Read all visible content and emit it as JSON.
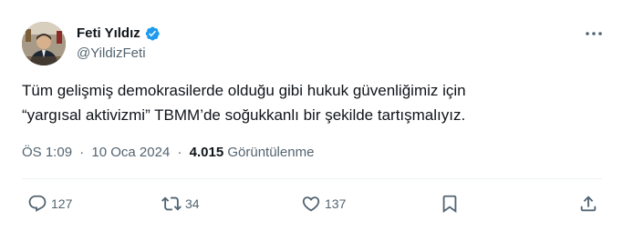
{
  "author": {
    "name": "Feti Yıldız",
    "handle": "@YildizFeti",
    "verified": true
  },
  "tweet": {
    "lines": [
      "Tüm gelişmiş demokrasilerde olduğu gibi hukuk güvenliğimiz için",
      "“yargısal aktivizmi” TBMM’de soğukkanlı bir şekilde tartışmalıyız."
    ]
  },
  "meta": {
    "time": "ÖS 1:09",
    "date": "10 Oca 2024",
    "separator": "·",
    "views_count": "4.015",
    "views_label": "Görüntülenme"
  },
  "actions": {
    "replies": "127",
    "retweets": "34",
    "likes": "137"
  },
  "icons": [
    "verified-badge-icon",
    "more-icon",
    "reply-icon",
    "retweet-icon",
    "like-icon",
    "bookmark-icon",
    "share-icon"
  ],
  "colors": {
    "verified": "#1d9bf0",
    "text": "#0f1419",
    "secondary": "#536471",
    "divider": "#eff3f4"
  }
}
